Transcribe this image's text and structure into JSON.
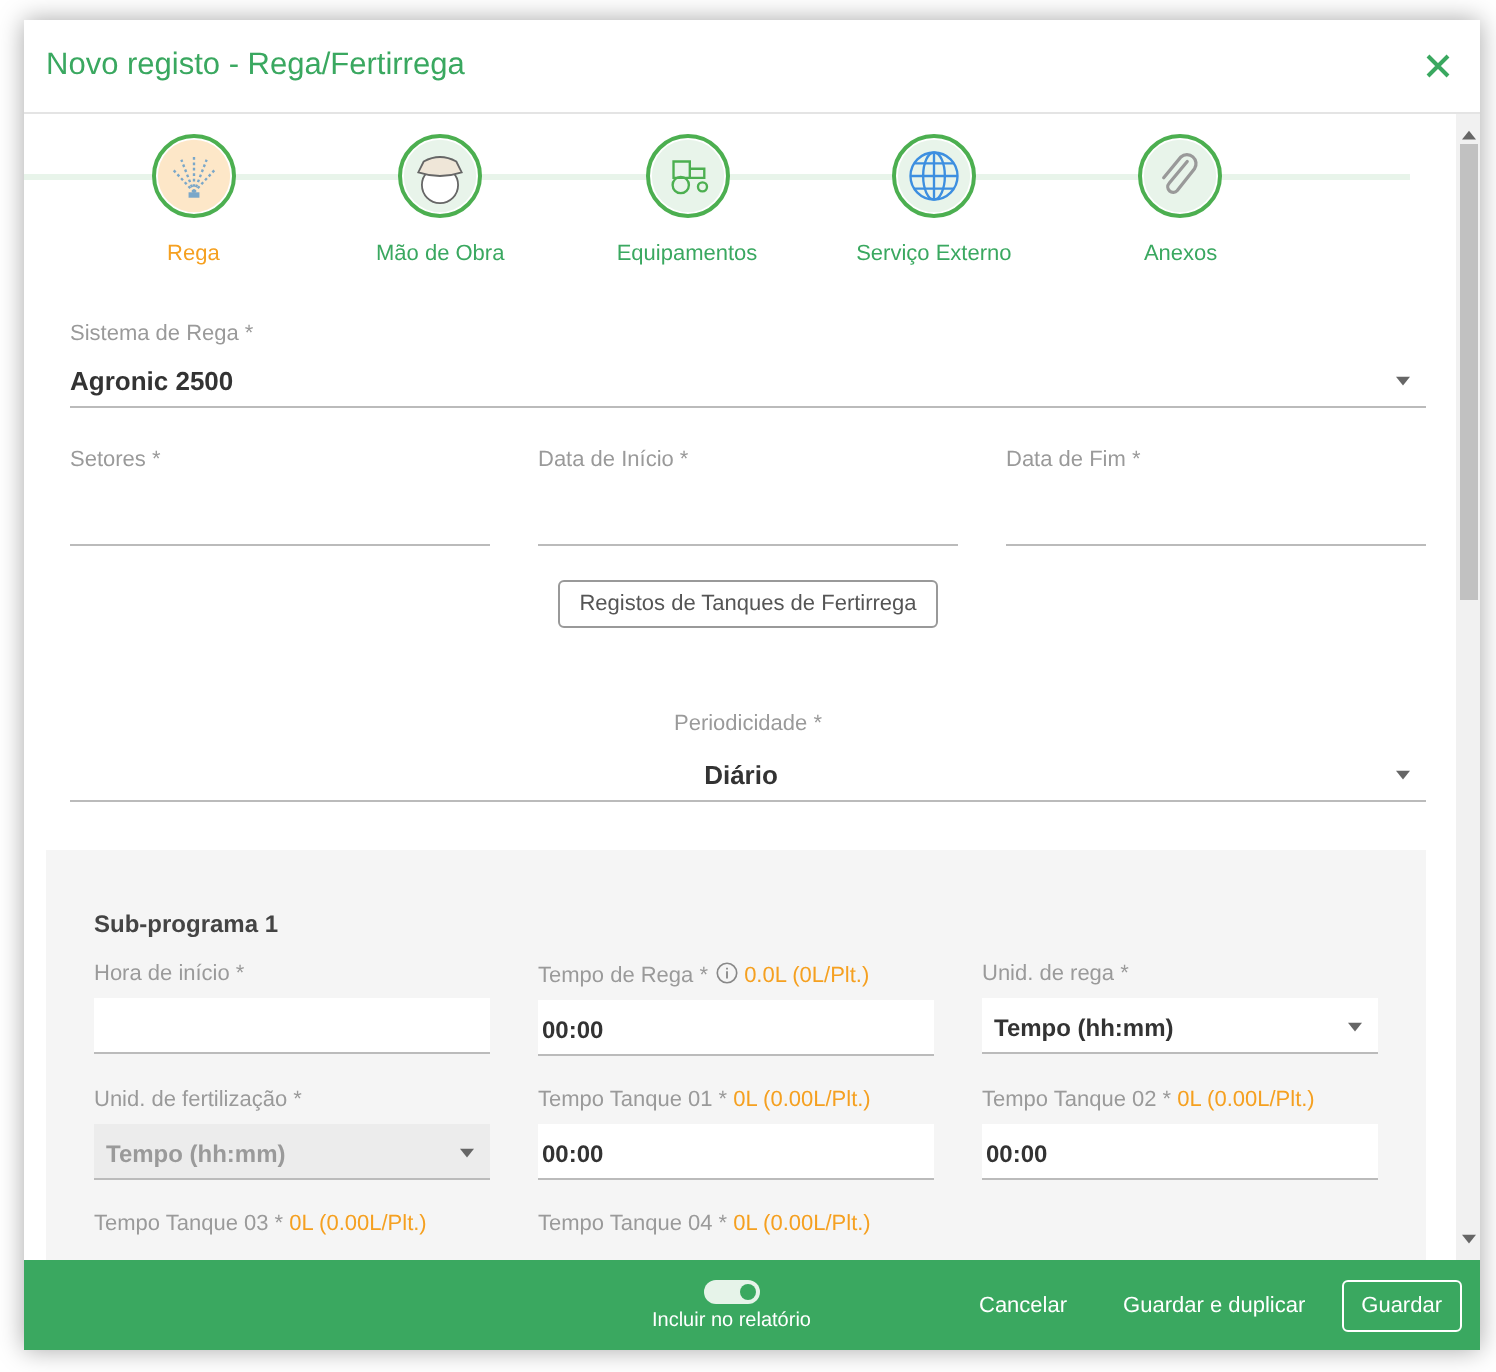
{
  "dialog": {
    "title": "Novo registo - Rega/Fertirrega"
  },
  "steps": [
    {
      "label": "Rega",
      "kind": "sprinkler",
      "selected": true
    },
    {
      "label": "Mão de Obra",
      "kind": "worker",
      "selected": false
    },
    {
      "label": "Equipamentos",
      "kind": "tractor",
      "selected": false
    },
    {
      "label": "Serviço Externo",
      "kind": "globe",
      "selected": false
    },
    {
      "label": "Anexos",
      "kind": "paperclip",
      "selected": false
    }
  ],
  "irrigation_system": {
    "label": "Sistema de Rega *",
    "value": "Agronic 2500"
  },
  "date_fields": [
    {
      "label": "Setores *"
    },
    {
      "label": "Data de Início *"
    },
    {
      "label": "Data de Fim *"
    }
  ],
  "tank_records_button": "Registos de Tanques de Fertirrega",
  "periodicity": {
    "label": "Periodicidade *",
    "value": "Diário"
  },
  "subprogram": {
    "title": "Sub-programa 1",
    "fields": [
      {
        "label": "Hora de início *",
        "kind": "text",
        "info": false,
        "disabled": false
      },
      {
        "label": "Tempo de Rega *",
        "kind": "text",
        "info": true,
        "note": "0.0L (0L/Plt.)",
        "value": "00:00",
        "disabled": false
      },
      {
        "label": "Unid. de rega *",
        "kind": "select",
        "info": false,
        "value": "Tempo (hh:mm)",
        "disabled": false
      },
      {
        "label": "Unid. de fertilização *",
        "kind": "select",
        "info": false,
        "value": "Tempo (hh:mm)",
        "disabled": true
      },
      {
        "label": "Tempo Tanque 01 *",
        "kind": "text",
        "info": false,
        "note": "0L (0.00L/Plt.)",
        "value": "00:00",
        "disabled": false
      },
      {
        "label": "Tempo Tanque 02 *",
        "kind": "text",
        "info": false,
        "note": "0L (0.00L/Plt.)",
        "value": "00:00",
        "disabled": false
      },
      {
        "label": "Tempo Tanque 03 *",
        "kind": "label_only",
        "info": false,
        "note": "0L (0.00L/Plt.)",
        "disabled": false
      },
      {
        "label": "Tempo Tanque 04 *",
        "kind": "label_only",
        "info": false,
        "note": "0L (0.00L/Plt.)",
        "disabled": false
      }
    ]
  },
  "footer": {
    "report_toggle": {
      "label": "Incluir no relatório",
      "on": true
    },
    "buttons": [
      {
        "label": "Cancelar",
        "kind": "text"
      },
      {
        "label": "Guardar e duplicar",
        "kind": "text"
      },
      {
        "label": "Guardar",
        "kind": "outlined"
      }
    ]
  }
}
